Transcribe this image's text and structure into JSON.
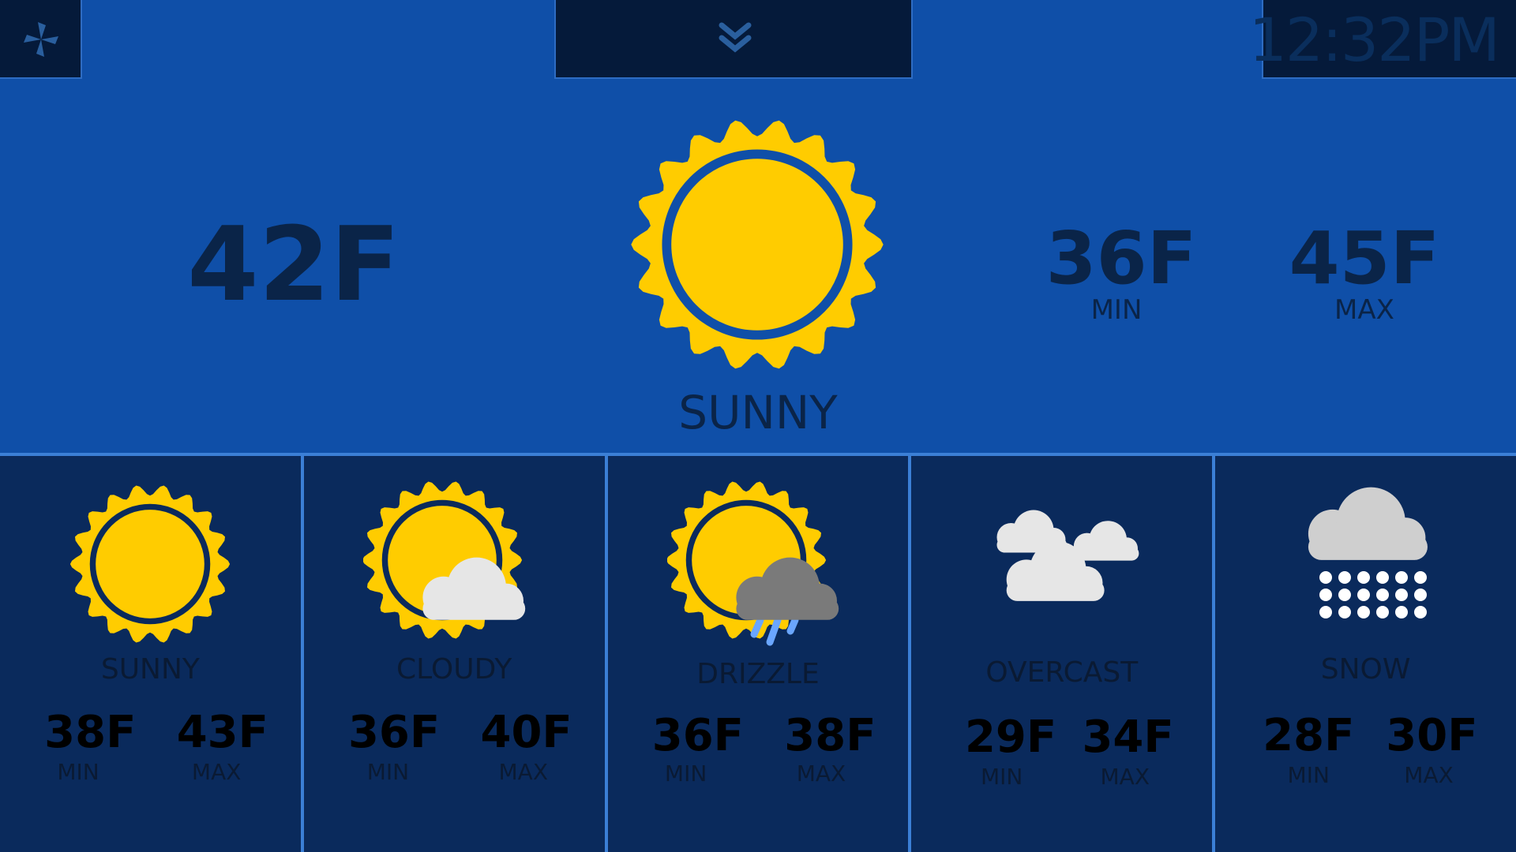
{
  "header": {
    "clock": "12:32PM"
  },
  "current": {
    "temp": "42F",
    "condition": "SUNNY",
    "min_value": "36F",
    "min_label": "MIN",
    "max_value": "45F",
    "max_label": "MAX",
    "icon": "sun-icon"
  },
  "forecast": [
    {
      "condition": "SUNNY",
      "min": "38F",
      "max": "43F",
      "min_label": "MIN",
      "max_label": "MAX",
      "icon": "sun-icon"
    },
    {
      "condition": "CLOUDY",
      "min": "36F",
      "max": "40F",
      "min_label": "MIN",
      "max_label": "MAX",
      "icon": "partly-cloudy-icon"
    },
    {
      "condition": "DRIZZLE",
      "min": "36F",
      "max": "38F",
      "min_label": "MIN",
      "max_label": "MAX",
      "icon": "drizzle-icon"
    },
    {
      "condition": "OVERCAST",
      "min": "29F",
      "max": "34F",
      "min_label": "MIN",
      "max_label": "MAX",
      "icon": "overcast-icon"
    },
    {
      "condition": "SNOW",
      "min": "28F",
      "max": "30F",
      "min_label": "MIN",
      "max_label": "MAX",
      "icon": "snow-icon"
    }
  ],
  "colors": {
    "background": "#0f4fa8",
    "forecast_panel": "#0a2a5c",
    "sun": "#ffcc00",
    "accent_line": "#3b7fd6"
  }
}
